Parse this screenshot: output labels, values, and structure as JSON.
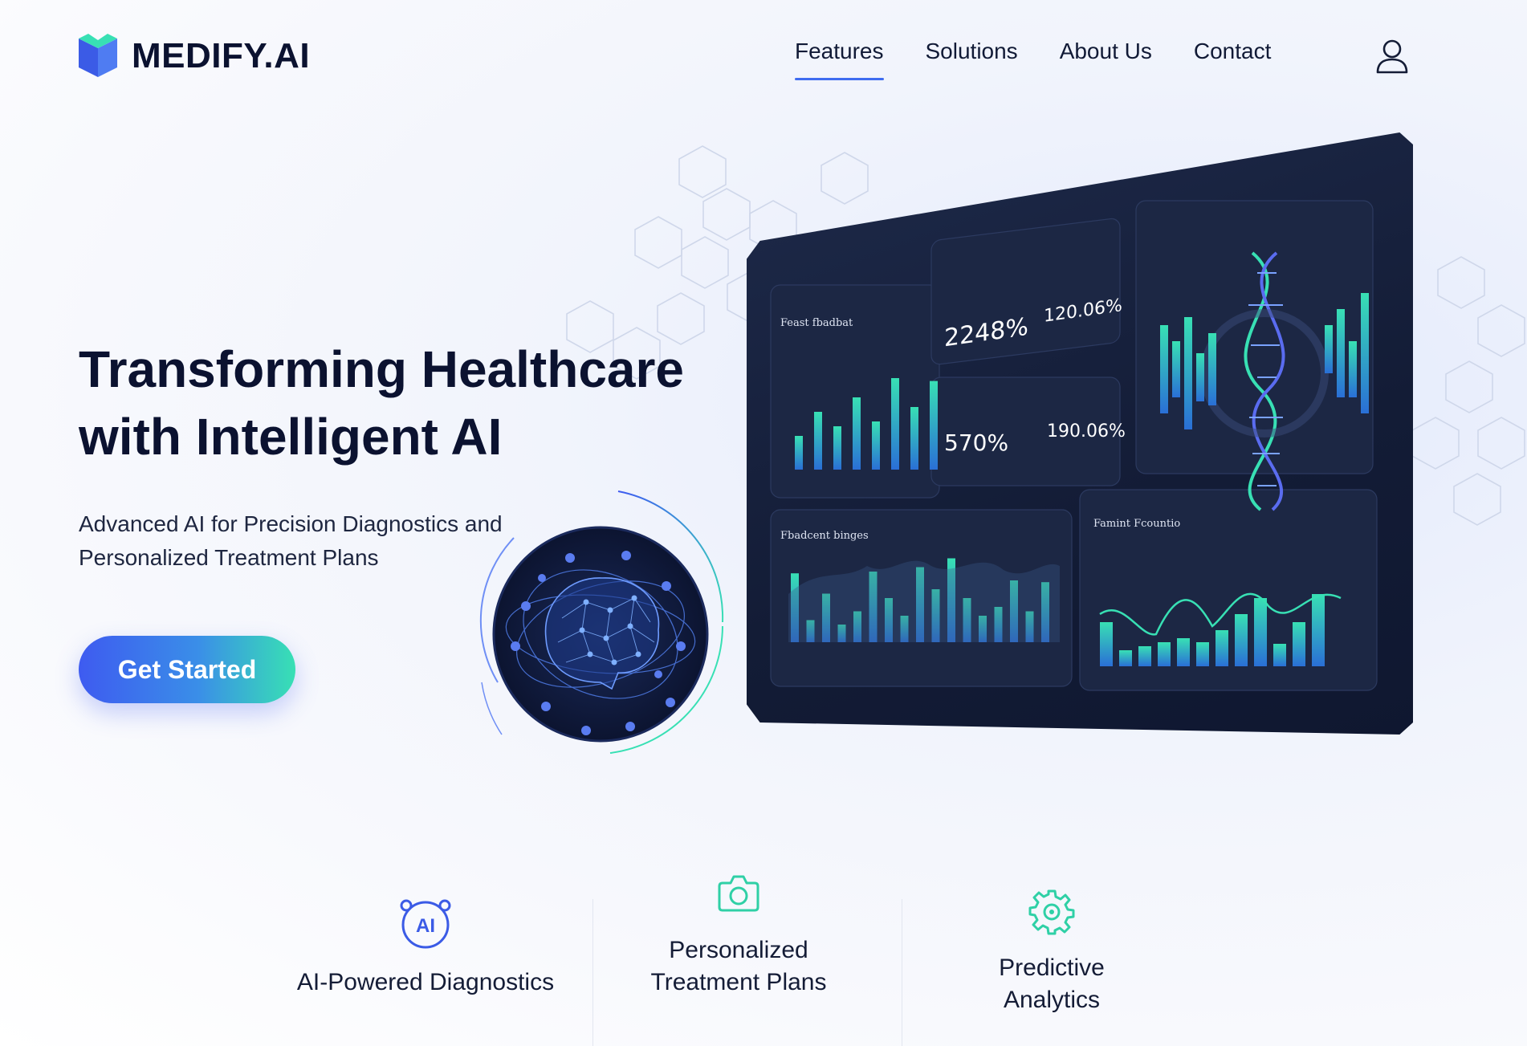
{
  "brand": {
    "name": "MEDIFY.AI"
  },
  "nav": {
    "items": [
      {
        "label": "Features",
        "active": true
      },
      {
        "label": "Solutions",
        "active": false
      },
      {
        "label": "About Us",
        "active": false
      },
      {
        "label": "Contact",
        "active": false
      }
    ]
  },
  "hero": {
    "title_line1": "Transforming Healthcare",
    "title_line2": "with Intelligent AI",
    "subtitle_line1": "Advanced AI for Precision Diagnostics and",
    "subtitle_line2": "Personalized Treatment Plans",
    "cta_label": "Get Started"
  },
  "dashboard": {
    "card1_title": "Feast fbadbat",
    "kpi1_value": "2248%",
    "kpi2_value": "120.06%",
    "kpi3_value": "570%",
    "kpi4_value": "190.06%",
    "card5_title": "Fbadcent binges",
    "card6_title": "Famint Fcountio",
    "chart1_bars": [
      0.35,
      0.6,
      0.45,
      0.75,
      0.5,
      0.95,
      0.65,
      0.92
    ],
    "chart2_bars": [
      0.78,
      0.25,
      0.55,
      0.2,
      0.35,
      0.8,
      0.5,
      0.3,
      0.85,
      0.6,
      0.95,
      0.5,
      0.3,
      0.4,
      0.7,
      0.35,
      0.68
    ],
    "chart3_bars": [
      0.55,
      0.2,
      0.25,
      0.3,
      0.35,
      0.3,
      0.45,
      0.65,
      0.85,
      0.28,
      0.55,
      0.9
    ],
    "colors": {
      "accent_teal": "#38e0b4",
      "accent_blue": "#3e5bf0",
      "panel_dark": "#131c36"
    }
  },
  "features": [
    {
      "label_line1": "AI-Powered Diagnostics",
      "label_line2": "",
      "icon": "ai-badge-icon",
      "icon_text": "AI"
    },
    {
      "label_line1": "Personalized",
      "label_line2": "Treatment Plans",
      "icon": "camera-gear-icon"
    },
    {
      "label_line1": "Predictive",
      "label_line2": "Analytics",
      "icon": "gear-icon"
    }
  ]
}
